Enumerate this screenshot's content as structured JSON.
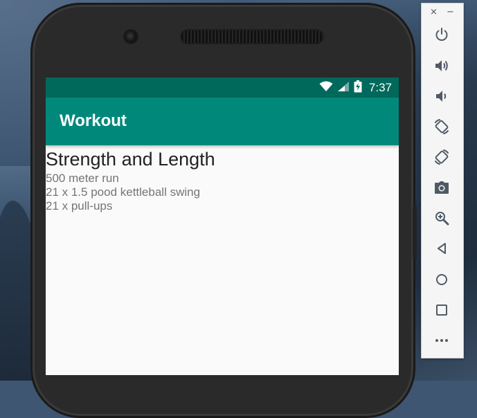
{
  "status_bar": {
    "time": "7:37",
    "icons": [
      "wifi-icon",
      "signal-icon",
      "battery-charging-icon"
    ]
  },
  "toolbar": {
    "title": "Workout"
  },
  "workout": {
    "title": "Strength and Length",
    "exercises": [
      "500 meter run",
      "21 x 1.5 pood kettleball swing",
      "21 x pull-ups"
    ]
  },
  "emulator_panel": {
    "close_label": "×",
    "minimize_label": "−",
    "buttons": [
      "power-icon",
      "volume-up-icon",
      "volume-down-icon",
      "rotate-left-icon",
      "rotate-right-icon",
      "camera-icon",
      "zoom-icon",
      "back-icon",
      "home-icon",
      "overview-icon",
      "more-icon"
    ]
  },
  "colors": {
    "status_bar": "#00695c",
    "toolbar": "#00897b",
    "screen_background": "#fafafa",
    "title_text": "#222222",
    "exercise_text": "#757575",
    "emulator_icon": "#505a66"
  }
}
